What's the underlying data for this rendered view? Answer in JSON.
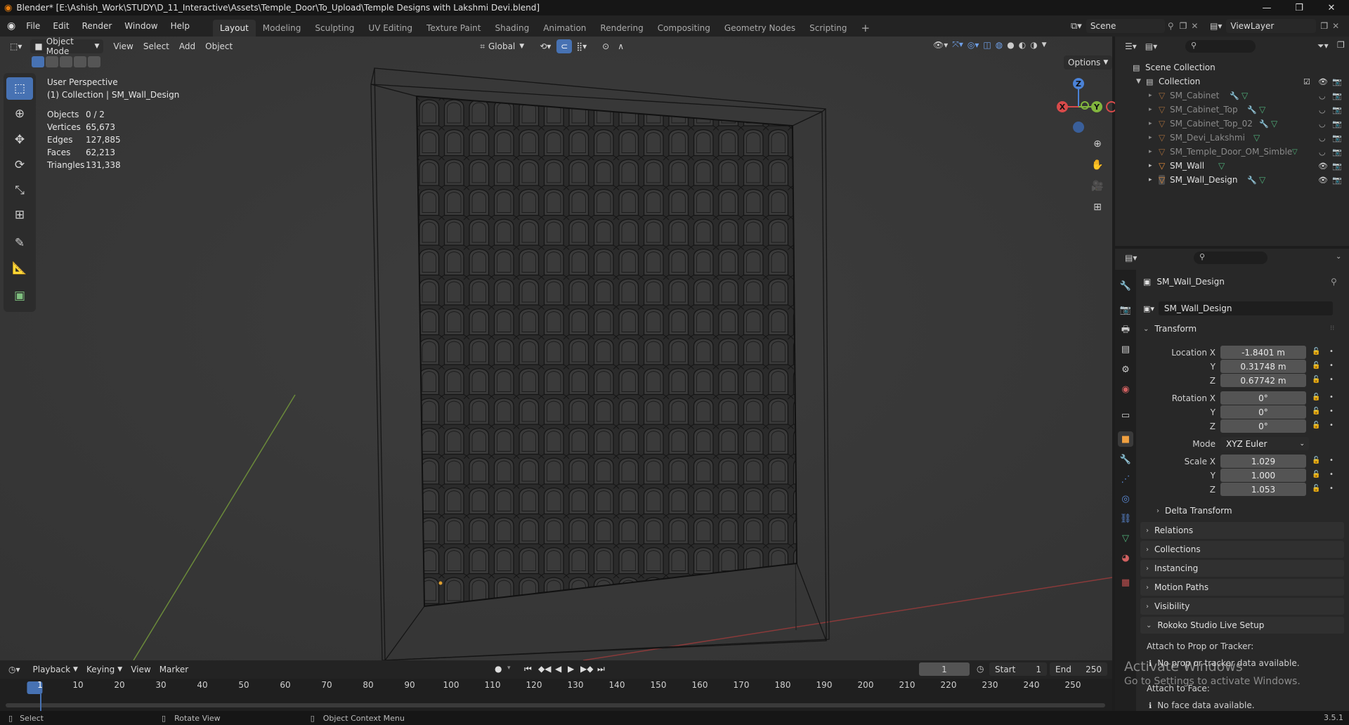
{
  "window": {
    "title": "Blender* [E:\\Ashish_Work\\STUDY\\D_11_Interactive\\Assets\\Temple_Door\\To_Upload\\Temple Designs with Lakshmi Devi.blend]"
  },
  "menu": {
    "items": [
      "File",
      "Edit",
      "Render",
      "Window",
      "Help"
    ],
    "workspaces": [
      "Layout",
      "Modeling",
      "Sculpting",
      "UV Editing",
      "Texture Paint",
      "Shading",
      "Animation",
      "Rendering",
      "Compositing",
      "Geometry Nodes",
      "Scripting"
    ],
    "add_tab": "+",
    "scene": "Scene",
    "view_layer": "ViewLayer"
  },
  "viewport_header": {
    "mode": "Object Mode",
    "menus": [
      "View",
      "Select",
      "Add",
      "Object"
    ],
    "orientation": "Global",
    "options": "Options"
  },
  "viewport": {
    "view_name": "User Perspective",
    "collection_info": "(1) Collection | SM_Wall_Design",
    "stats": [
      {
        "label": "Objects",
        "value": "0 / 2"
      },
      {
        "label": "Vertices",
        "value": "65,673"
      },
      {
        "label": "Edges",
        "value": "127,885"
      },
      {
        "label": "Faces",
        "value": "62,213"
      },
      {
        "label": "Triangles",
        "value": "131,338"
      }
    ],
    "gizmo": {
      "x": "X",
      "y": "Y",
      "z": "Z"
    }
  },
  "outliner": {
    "scene_collection": "Scene Collection",
    "collection": "Collection",
    "items": [
      "SM_Cabinet",
      "SM_Cabinet_Top",
      "SM_Cabinet_Top_02",
      "SM_Devi_Lakshmi",
      "SM_Temple_Door_OM_Simble",
      "SM_Wall",
      "SM_Wall_Design"
    ]
  },
  "properties": {
    "object_name": "SM_Wall_Design",
    "datablock_name": "SM_Wall_Design",
    "transform_label": "Transform",
    "location": {
      "label": "Location X",
      "x": "-1.8401 m",
      "y": "0.31748 m",
      "z": "0.67742 m"
    },
    "rotation": {
      "label": "Rotation X",
      "x": "0°",
      "y": "0°",
      "z": "0°"
    },
    "mode_label": "Mode",
    "mode_value": "XYZ Euler",
    "scale": {
      "label": "Scale X",
      "x": "1.029",
      "y": "1.000",
      "z": "1.053"
    },
    "axis_y": "Y",
    "axis_z": "Z",
    "delta_transform": "Delta Transform",
    "panels": [
      "Relations",
      "Collections",
      "Instancing",
      "Motion Paths",
      "Visibility"
    ],
    "rokoko": {
      "title": "Rokoko Studio Live Setup",
      "attach_prop": "Attach to Prop or Tracker:",
      "no_prop": "No prop or tracker data available.",
      "attach_face": "Attach to Face:",
      "no_face": "No face data available."
    }
  },
  "timeline": {
    "menus": [
      "Playback",
      "Keying",
      "View",
      "Marker"
    ],
    "current_frame": "1",
    "start_label": "Start",
    "start_value": "1",
    "end_label": "End",
    "end_value": "250",
    "ticks": [
      "1",
      "10",
      "20",
      "30",
      "40",
      "50",
      "60",
      "70",
      "80",
      "90",
      "100",
      "110",
      "120",
      "130",
      "140",
      "150",
      "160",
      "170",
      "180",
      "190",
      "200",
      "210",
      "220",
      "230",
      "240",
      "250"
    ]
  },
  "activation": {
    "title": "Activate Windows",
    "subtitle": "Go to Settings to activate Windows."
  },
  "statusbar": {
    "select": "Select",
    "rotate": "Rotate View",
    "context_menu": "Object Context Menu",
    "version": "3.5.1"
  }
}
